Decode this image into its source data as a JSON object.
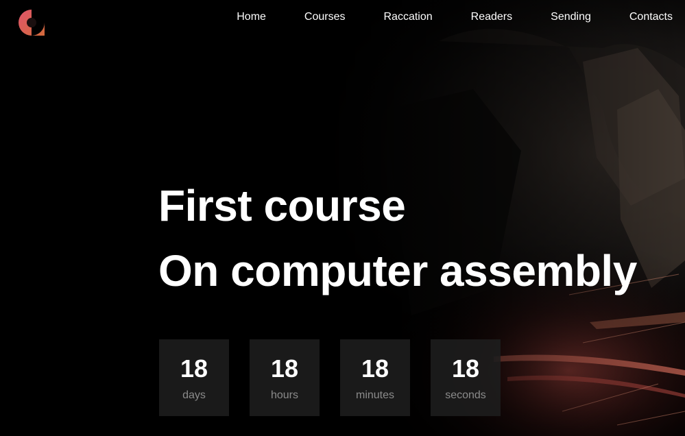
{
  "nav": {
    "items": [
      {
        "label": "Home"
      },
      {
        "label": "Courses"
      },
      {
        "label": "Raccation"
      },
      {
        "label": "Readers"
      },
      {
        "label": "Sending"
      },
      {
        "label": "Contacts"
      }
    ]
  },
  "logo": {
    "icon": "brand-logo-icon",
    "colors": [
      "#e0556b",
      "#d36a3b"
    ]
  },
  "hero": {
    "title_line1": "First course",
    "title_line2": "On computer assembly",
    "countdown": [
      {
        "value": "18",
        "unit": "days"
      },
      {
        "value": "18",
        "unit": "hours"
      },
      {
        "value": "18",
        "unit": "minutes"
      },
      {
        "value": "18",
        "unit": "seconds"
      }
    ]
  }
}
